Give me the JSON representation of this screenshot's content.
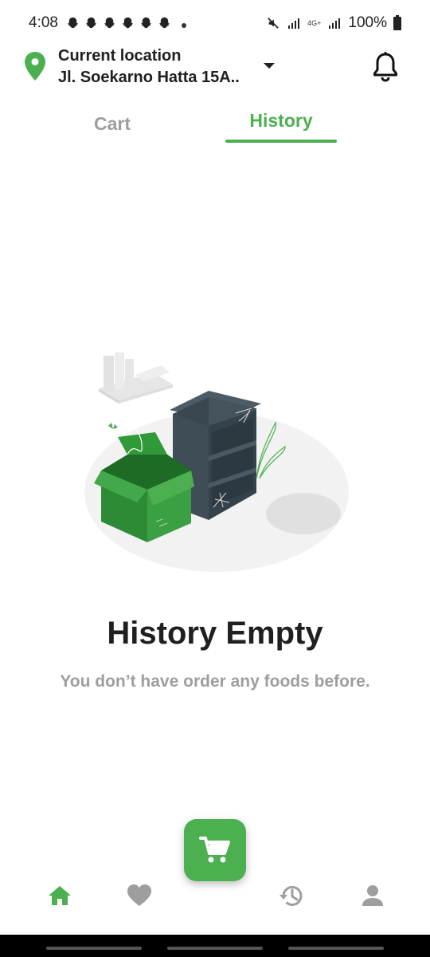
{
  "status_bar": {
    "time": "4:08",
    "notification_icons": [
      "snapchat-icon",
      "snapchat-icon",
      "snapchat-icon",
      "snapchat-icon",
      "snapchat-icon",
      "snapchat-icon"
    ],
    "network": "4G+",
    "battery": "100%"
  },
  "header": {
    "location_label": "Current location",
    "address": "Jl. Soekarno Hatta 15A..",
    "icons": [
      "location-pin-icon",
      "caret-down-icon",
      "bell-icon"
    ]
  },
  "tabs": [
    {
      "label": "Cart",
      "active": false
    },
    {
      "label": "History",
      "active": true
    }
  ],
  "empty_state": {
    "title": "History Empty",
    "subtitle": "You don’t have order any foods before."
  },
  "bottom_nav": {
    "items": [
      {
        "icon": "home-icon",
        "active": true
      },
      {
        "icon": "heart-icon",
        "active": false
      },
      {
        "icon": "history-icon",
        "active": false
      },
      {
        "icon": "person-icon",
        "active": false
      }
    ],
    "fab_icon": "cart-icon"
  },
  "colors": {
    "accent": "#4caf50",
    "text_primary": "#1f1f1f",
    "text_secondary": "#9e9e9e",
    "icon_inactive": "#9e9e9e"
  }
}
